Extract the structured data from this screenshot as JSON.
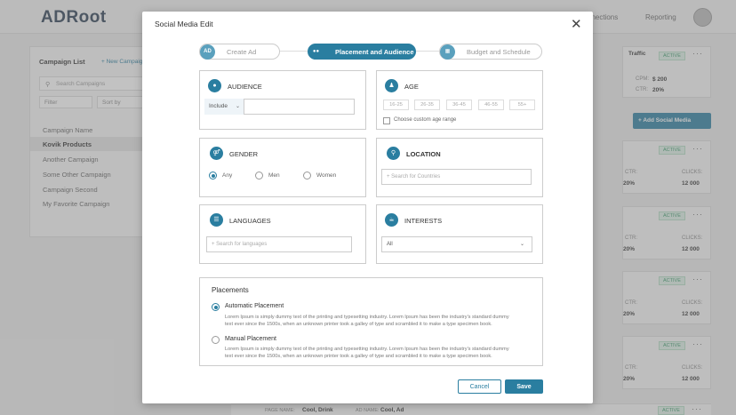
{
  "app": {
    "logo": "ADRoot",
    "nav": [
      "nnections",
      "Reporting"
    ]
  },
  "campaign_list": {
    "title": "Campaign List",
    "new_label": "+ New Campaign",
    "search_placeholder": "Search Campaigns",
    "filter_label": "Filter",
    "sort_label": "Sort by",
    "items": [
      "Campaign Name",
      "Kovik Products",
      "Another Campaign",
      "Some Other Campaign",
      "Campaign Second",
      "My Favorite Campaign"
    ],
    "active_index": 1
  },
  "right_panel": {
    "traffic_label": "Traffic",
    "status": "ACTIVE",
    "cpm_label": "CPM:",
    "cpm_value": "$ 200",
    "ctr_label": "CTR:",
    "ctr_value": "20%",
    "add_social_label": "+ Add Social Media",
    "cards": [
      {
        "status": "ACTIVE",
        "ctr_label": "CTR:",
        "ctr_value": "20%",
        "clicks_label": "CLICKS:",
        "clicks_value": "12 000"
      },
      {
        "status": "ACTIVE",
        "ctr_label": "CTR:",
        "ctr_value": "20%",
        "clicks_label": "CLICKS:",
        "clicks_value": "12 000"
      },
      {
        "status": "ACTIVE",
        "ctr_label": "CTR:",
        "ctr_value": "20%",
        "clicks_label": "CLICKS:",
        "clicks_value": "12 000"
      },
      {
        "status": "ACTIVE",
        "ctr_label": "CTR:",
        "ctr_value": "20%",
        "clicks_label": "CLICKS:",
        "clicks_value": "12 000"
      }
    ],
    "bottom_status": "ACTIVE"
  },
  "bottom_row": {
    "page_name_label": "PAGE NAME:",
    "page_name_value": "Cool, Drink",
    "ad_name_label": "AD NAME:",
    "ad_name_value": "Cool, Ad"
  },
  "modal": {
    "title": "Social Media Edit",
    "steps": [
      {
        "label": "Create Ad",
        "icon": "AD"
      },
      {
        "label": "Placement and Audience",
        "icon": "people-icon"
      },
      {
        "label": "Budget and Schedule",
        "icon": "calendar-icon"
      }
    ],
    "active_step": 1,
    "audience": {
      "title": "AUDIENCE",
      "include_value": "Include",
      "input_value": ""
    },
    "age": {
      "title": "AGE",
      "ranges": [
        "16-25",
        "26-35",
        "36-45",
        "46-55",
        "55+"
      ],
      "custom_label": "Choose custom age range"
    },
    "gender": {
      "title": "GENDER",
      "options": [
        "Any",
        "Men",
        "Women"
      ],
      "selected": "Any"
    },
    "location": {
      "title": "LOCATION",
      "placeholder": "+ Search for Countries"
    },
    "languages": {
      "title": "LANGUAGES",
      "placeholder": "+ Search for languages"
    },
    "interests": {
      "title": "INTERESTS",
      "value": "All"
    },
    "placements": {
      "title": "Placements",
      "options": [
        {
          "label": "Automatic Placement",
          "desc": "Lorem Ipsum is simply dummy text of the printing and typesetting industry. Lorem Ipsum has been the industry's standard dummy text ever since the 1500s, when an unknown printer took a galley of type and scrambled it to make a type specimen book.",
          "checked": true
        },
        {
          "label": "Manual Placement",
          "desc": "Lorem Ipsum is simply dummy text of the printing and typesetting industry. Lorem Ipsum has been the industry's standard dummy text ever since the 1500s, when an unknown printer took a galley of type and scrambled it to make a type specimen book.",
          "checked": false
        }
      ]
    },
    "cancel_label": "Cancel",
    "save_label": "Save"
  },
  "colors": {
    "accent": "#2a7ea0",
    "active_badge": "#3a9a6a"
  }
}
